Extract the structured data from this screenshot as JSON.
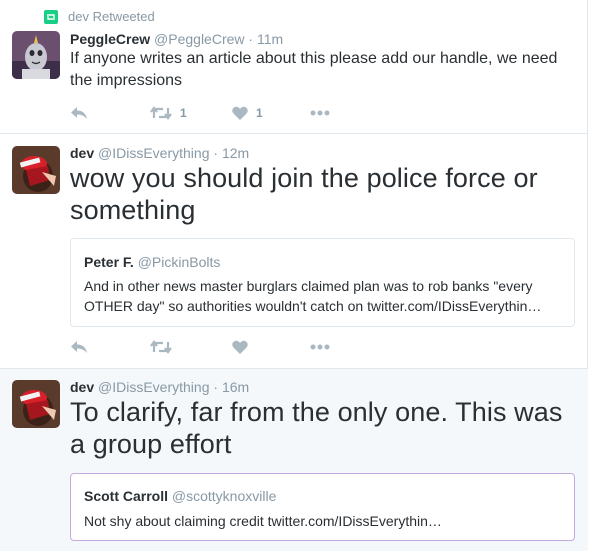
{
  "feed": {
    "tweets": [
      {
        "context": "dev Retweeted",
        "name": "PeggleCrew",
        "handle": "@PeggleCrew",
        "separator": "·",
        "time": "11m",
        "text": "If anyone writes an article about this please add our handle, we need the impressions",
        "retweet_count": "1",
        "like_count": "1"
      },
      {
        "name": "dev",
        "handle": "@IDissEverything",
        "separator": "·",
        "time": "12m",
        "text": "wow you should join the police force or something",
        "quote": {
          "name": "Peter F.",
          "handle": "@PickinBolts",
          "text": "And in other news master burglars claimed plan was to rob banks \"every OTHER day\" so authorities wouldn't catch on twitter.com/IDissEverythin…"
        }
      },
      {
        "name": "dev",
        "handle": "@IDissEverything",
        "separator": "·",
        "time": "16m",
        "text": "To clarify, far from the only one. This was a group effort",
        "quote": {
          "name": "Scott Carroll",
          "handle": "@scottyknoxville",
          "text": "Not shy about claiming credit twitter.com/IDissEverythin…"
        }
      }
    ]
  },
  "colors": {
    "accent_green": "#19cf86",
    "icon_gray": "#aab8c2",
    "meta_gray": "#8899a6",
    "quote_highlight_border": "#c4a9df"
  },
  "icons": [
    "retweet-icon",
    "reply-icon",
    "heart-icon",
    "more-icon"
  ]
}
